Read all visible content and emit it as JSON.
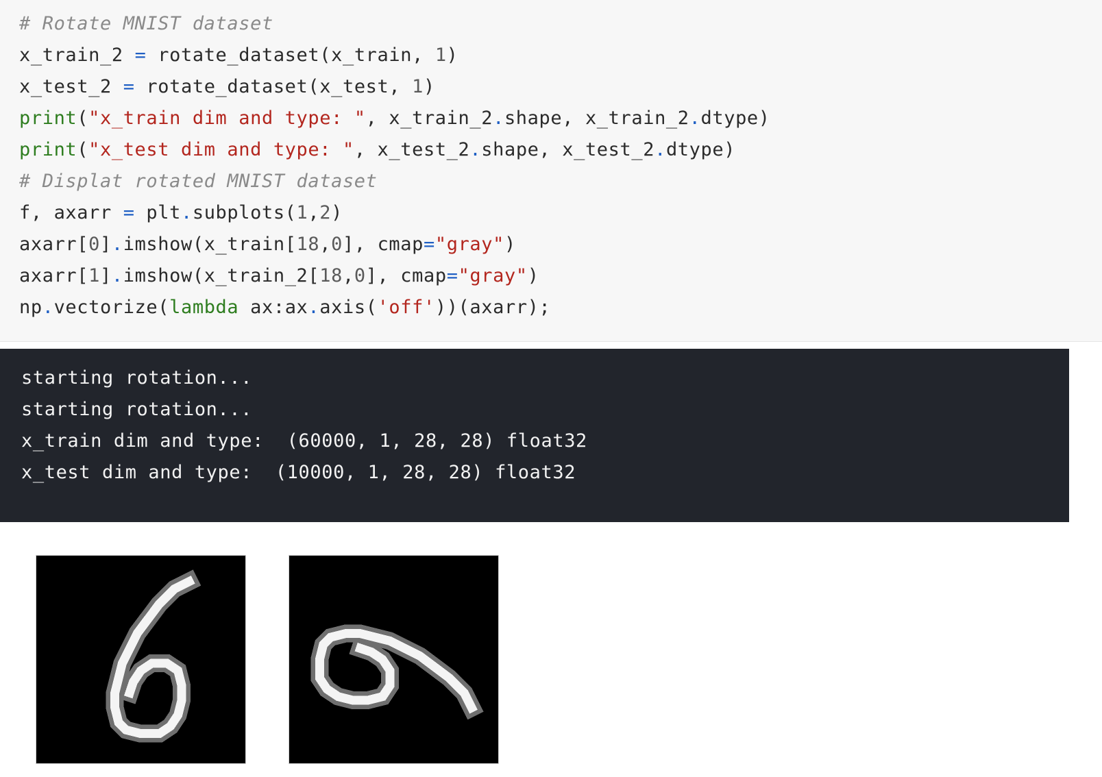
{
  "code_cell": {
    "lines": [
      [
        {
          "t": "# Rotate MNIST dataset",
          "c": "comment"
        }
      ],
      [
        {
          "t": "x_train_2 ",
          "c": "plain"
        },
        {
          "t": "=",
          "c": "op"
        },
        {
          "t": " rotate_dataset(x_train, ",
          "c": "plain"
        },
        {
          "t": "1",
          "c": "num"
        },
        {
          "t": ")",
          "c": "plain"
        }
      ],
      [
        {
          "t": "x_test_2 ",
          "c": "plain"
        },
        {
          "t": "=",
          "c": "op"
        },
        {
          "t": " rotate_dataset(x_test, ",
          "c": "plain"
        },
        {
          "t": "1",
          "c": "num"
        },
        {
          "t": ")",
          "c": "plain"
        }
      ],
      [
        {
          "t": "print",
          "c": "builtin"
        },
        {
          "t": "(",
          "c": "plain"
        },
        {
          "t": "\"x_train dim and type: \"",
          "c": "str"
        },
        {
          "t": ", x_train_2",
          "c": "plain"
        },
        {
          "t": ".",
          "c": "op"
        },
        {
          "t": "shape, x_train_2",
          "c": "plain"
        },
        {
          "t": ".",
          "c": "op"
        },
        {
          "t": "dtype)",
          "c": "plain"
        }
      ],
      [
        {
          "t": "print",
          "c": "builtin"
        },
        {
          "t": "(",
          "c": "plain"
        },
        {
          "t": "\"x_test dim and type: \"",
          "c": "str"
        },
        {
          "t": ", x_test_2",
          "c": "plain"
        },
        {
          "t": ".",
          "c": "op"
        },
        {
          "t": "shape, x_test_2",
          "c": "plain"
        },
        {
          "t": ".",
          "c": "op"
        },
        {
          "t": "dtype)",
          "c": "plain"
        }
      ],
      [
        {
          "t": "# Displat rotated MNIST dataset",
          "c": "comment"
        }
      ],
      [
        {
          "t": "f, axarr ",
          "c": "plain"
        },
        {
          "t": "=",
          "c": "op"
        },
        {
          "t": " plt",
          "c": "plain"
        },
        {
          "t": ".",
          "c": "op"
        },
        {
          "t": "subplots(",
          "c": "plain"
        },
        {
          "t": "1",
          "c": "num"
        },
        {
          "t": ",",
          "c": "plain"
        },
        {
          "t": "2",
          "c": "num"
        },
        {
          "t": ")",
          "c": "plain"
        }
      ],
      [
        {
          "t": "axarr[",
          "c": "plain"
        },
        {
          "t": "0",
          "c": "num"
        },
        {
          "t": "]",
          "c": "plain"
        },
        {
          "t": ".",
          "c": "op"
        },
        {
          "t": "imshow(x_train[",
          "c": "plain"
        },
        {
          "t": "18",
          "c": "num"
        },
        {
          "t": ",",
          "c": "plain"
        },
        {
          "t": "0",
          "c": "num"
        },
        {
          "t": "], cmap",
          "c": "plain"
        },
        {
          "t": "=",
          "c": "op"
        },
        {
          "t": "\"gray\"",
          "c": "str"
        },
        {
          "t": ")",
          "c": "plain"
        }
      ],
      [
        {
          "t": "axarr[",
          "c": "plain"
        },
        {
          "t": "1",
          "c": "num"
        },
        {
          "t": "]",
          "c": "plain"
        },
        {
          "t": ".",
          "c": "op"
        },
        {
          "t": "imshow(x_train_2[",
          "c": "plain"
        },
        {
          "t": "18",
          "c": "num"
        },
        {
          "t": ",",
          "c": "plain"
        },
        {
          "t": "0",
          "c": "num"
        },
        {
          "t": "], cmap",
          "c": "plain"
        },
        {
          "t": "=",
          "c": "op"
        },
        {
          "t": "\"gray\"",
          "c": "str"
        },
        {
          "t": ")",
          "c": "plain"
        }
      ],
      [
        {
          "t": "np",
          "c": "plain"
        },
        {
          "t": ".",
          "c": "op"
        },
        {
          "t": "vectorize(",
          "c": "plain"
        },
        {
          "t": "lambda",
          "c": "builtin"
        },
        {
          "t": " ax:ax",
          "c": "plain"
        },
        {
          "t": ".",
          "c": "op"
        },
        {
          "t": "axis(",
          "c": "plain"
        },
        {
          "t": "'off'",
          "c": "str"
        },
        {
          "t": "))(axarr);",
          "c": "plain"
        }
      ]
    ]
  },
  "output_cell": {
    "lines": [
      "starting rotation...",
      "starting rotation...",
      "x_train dim and type:  (60000, 1, 28, 28) float32",
      "x_test dim and type:  (10000, 1, 28, 28) float32"
    ]
  },
  "figures": [
    {
      "title": "",
      "content": "handwritten digit 6, original orientation"
    },
    {
      "title": "",
      "content": "handwritten digit 6, rotated 90 degrees"
    }
  ],
  "colors": {
    "code_bg": "#f7f7f7",
    "output_bg": "#22252c",
    "comment": "#8a8a8a",
    "builtin": "#2e7d1f",
    "string": "#b3261e",
    "operator": "#1f5fc4"
  }
}
